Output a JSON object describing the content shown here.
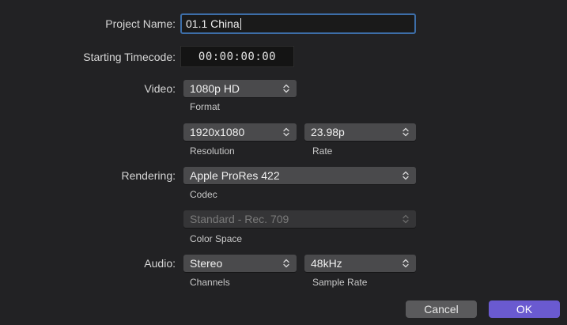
{
  "project": {
    "name_label": "Project Name:",
    "name_value": "01.1 China",
    "timecode_label": "Starting Timecode:",
    "timecode_value": "00:00:00:00"
  },
  "video": {
    "label": "Video:",
    "format_value": "1080p HD",
    "format_caption": "Format",
    "resolution_value": "1920x1080",
    "resolution_caption": "Resolution",
    "rate_value": "23.98p",
    "rate_caption": "Rate"
  },
  "rendering": {
    "label": "Rendering:",
    "codec_value": "Apple ProRes 422",
    "codec_caption": "Codec",
    "colorspace_value": "Standard - Rec. 709",
    "colorspace_caption": "Color Space"
  },
  "audio": {
    "label": "Audio:",
    "channels_value": "Stereo",
    "channels_caption": "Channels",
    "samplerate_value": "48kHz",
    "samplerate_caption": "Sample Rate"
  },
  "buttons": {
    "cancel": "Cancel",
    "ok": "OK"
  },
  "colors": {
    "accent": "#6a5ad0",
    "focus_ring": "#3d6ea8",
    "background": "#222224"
  },
  "icons": {
    "popup_arrows": "chevron-updown-icon"
  }
}
